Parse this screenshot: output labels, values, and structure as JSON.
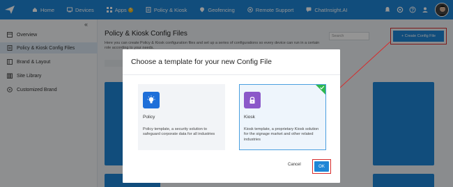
{
  "topbar": {
    "nav": [
      {
        "label": "Home",
        "icon": "home-icon"
      },
      {
        "label": "Devices",
        "icon": "devices-icon"
      },
      {
        "label": "Apps",
        "icon": "apps-icon",
        "badge": "5"
      },
      {
        "label": "Policy & Kiosk",
        "icon": "policy-icon"
      },
      {
        "label": "Geofencing",
        "icon": "geofencing-icon"
      },
      {
        "label": "Remote Support",
        "icon": "remote-support-icon"
      },
      {
        "label": "ChatInsight.AI",
        "icon": "chat-icon"
      }
    ],
    "right_icons": [
      "notification-icon",
      "settings-icon",
      "help-icon",
      "user-icon"
    ]
  },
  "sidebar": {
    "collapse": "«",
    "items": [
      {
        "label": "Overview",
        "icon": "overview-icon"
      },
      {
        "label": "Policy & Kiosk Config Files",
        "icon": "config-files-icon",
        "active": true
      },
      {
        "label": "Brand & Layout",
        "icon": "brand-icon"
      },
      {
        "label": "Site Library",
        "icon": "library-icon"
      },
      {
        "label": "Customized Brand",
        "icon": "customized-brand-icon"
      }
    ]
  },
  "main": {
    "title": "Policy & Kiosk Config Files",
    "description": "Here you can create Policy & Kiosk configuration files and set up a series of configurations so every device can run in a certain role according to your needs.",
    "search_placeholder": "Search",
    "create_button": "+ Create Config File"
  },
  "dialog": {
    "title": "Choose a template for your new Config File",
    "templates": [
      {
        "name": "Policy",
        "icon": "lightbulb-icon",
        "description": "Policy template, a security solution to safeguard corporate data for all industries",
        "selected": false
      },
      {
        "name": "Kiosk",
        "icon": "lock-icon",
        "description": "Kiosk template, a proprietary Kiosk solution for the signage market and other related industries",
        "selected": true
      }
    ],
    "cancel_label": "Cancel",
    "ok_label": "OK"
  },
  "colors": {
    "brand": "#1e86d6",
    "policy_icon_bg": "#1e6fd9",
    "kiosk_icon_bg": "#8b58c9",
    "selected_check": "#2fb84e",
    "highlight": "#d72b2b"
  }
}
